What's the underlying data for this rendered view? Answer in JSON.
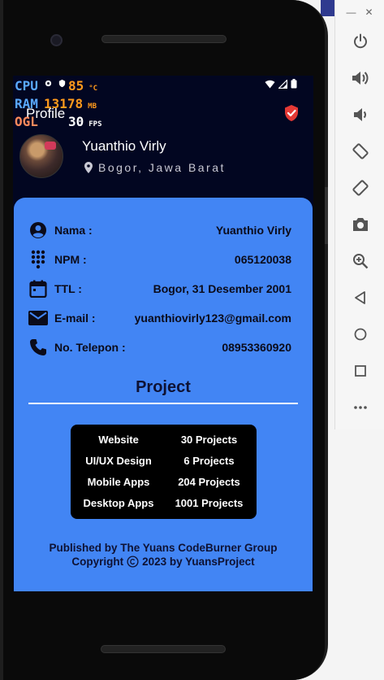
{
  "status": {
    "perf_rows": [
      {
        "key": "CPU",
        "value": "85",
        "unit": "°C"
      },
      {
        "key": "RAM",
        "value": "13178",
        "unit": "MB"
      },
      {
        "key": "OGL",
        "value": "30",
        "unit": "FPS"
      }
    ]
  },
  "appbar": {
    "title": "Profile"
  },
  "profile": {
    "name": "Yuanthio Virly",
    "location": "Bogor, Jawa Barat"
  },
  "info": [
    {
      "icon": "account-icon",
      "label": "Nama :",
      "value": "Yuanthio Virly"
    },
    {
      "icon": "dialpad-icon",
      "label": "NPM :",
      "value": "065120038"
    },
    {
      "icon": "calendar-icon",
      "label": "TTL :",
      "value": "Bogor, 31 Desember 2001"
    },
    {
      "icon": "mail-icon",
      "label": "E-mail :",
      "value": "yuanthiovirly123@gmail.com"
    },
    {
      "icon": "phone-icon",
      "label": "No. Telepon :",
      "value": "08953360920"
    }
  ],
  "project": {
    "title": "Project",
    "rows": [
      {
        "name": "Website",
        "count": "30 Projects"
      },
      {
        "name": "UI/UX Design",
        "count": "6 Projects"
      },
      {
        "name": "Mobile Apps",
        "count": "204 Projects"
      },
      {
        "name": "Desktop Apps",
        "count": "1001 Projects"
      }
    ]
  },
  "footer": {
    "line1": "Published by The Yuans CodeBurner Group",
    "line2_pre": "Copyright",
    "line2_post": "2023 by YuansProject"
  },
  "colors": {
    "accent": "#4285f4",
    "screen_bg": "#020621",
    "shield": "#e53935"
  }
}
